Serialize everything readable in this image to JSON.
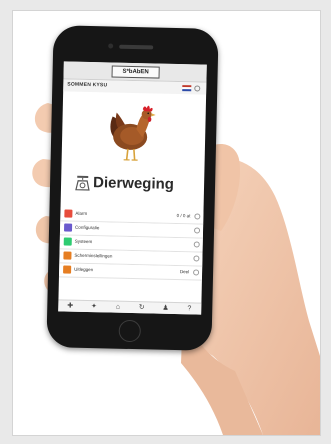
{
  "app": {
    "logo_text": "S*bAbEN",
    "subtitle": "SOMMEN KYSU",
    "title": "Dierweging"
  },
  "colors": {
    "flag_red": "#c0392b",
    "flag_white": "#ffffff",
    "flag_blue": "#2c4aa8"
  },
  "menu": [
    {
      "label": "Alarm",
      "value": "0 / 0 at",
      "color": "#e74c3c",
      "icon": "alarm-icon"
    },
    {
      "label": "Configuratie",
      "value": "",
      "color": "#6a5acd",
      "icon": "config-icon"
    },
    {
      "label": "Systeem",
      "value": "",
      "color": "#2ecc71",
      "icon": "system-icon"
    },
    {
      "label": "Scherminstellingen",
      "value": "",
      "color": "#e67e22",
      "icon": "display-icon"
    },
    {
      "label": "Uitleggen",
      "value": "Deel",
      "color": "#e67e22",
      "icon": "export-icon"
    }
  ],
  "bottom_bar": [
    {
      "glyph": "✚",
      "icon": "add-icon"
    },
    {
      "glyph": "✦",
      "icon": "tools-icon"
    },
    {
      "glyph": "⌂",
      "icon": "home-icon"
    },
    {
      "glyph": "↻",
      "icon": "refresh-icon"
    },
    {
      "glyph": "♟",
      "icon": "user-icon"
    },
    {
      "glyph": "?",
      "icon": "help-icon"
    }
  ]
}
